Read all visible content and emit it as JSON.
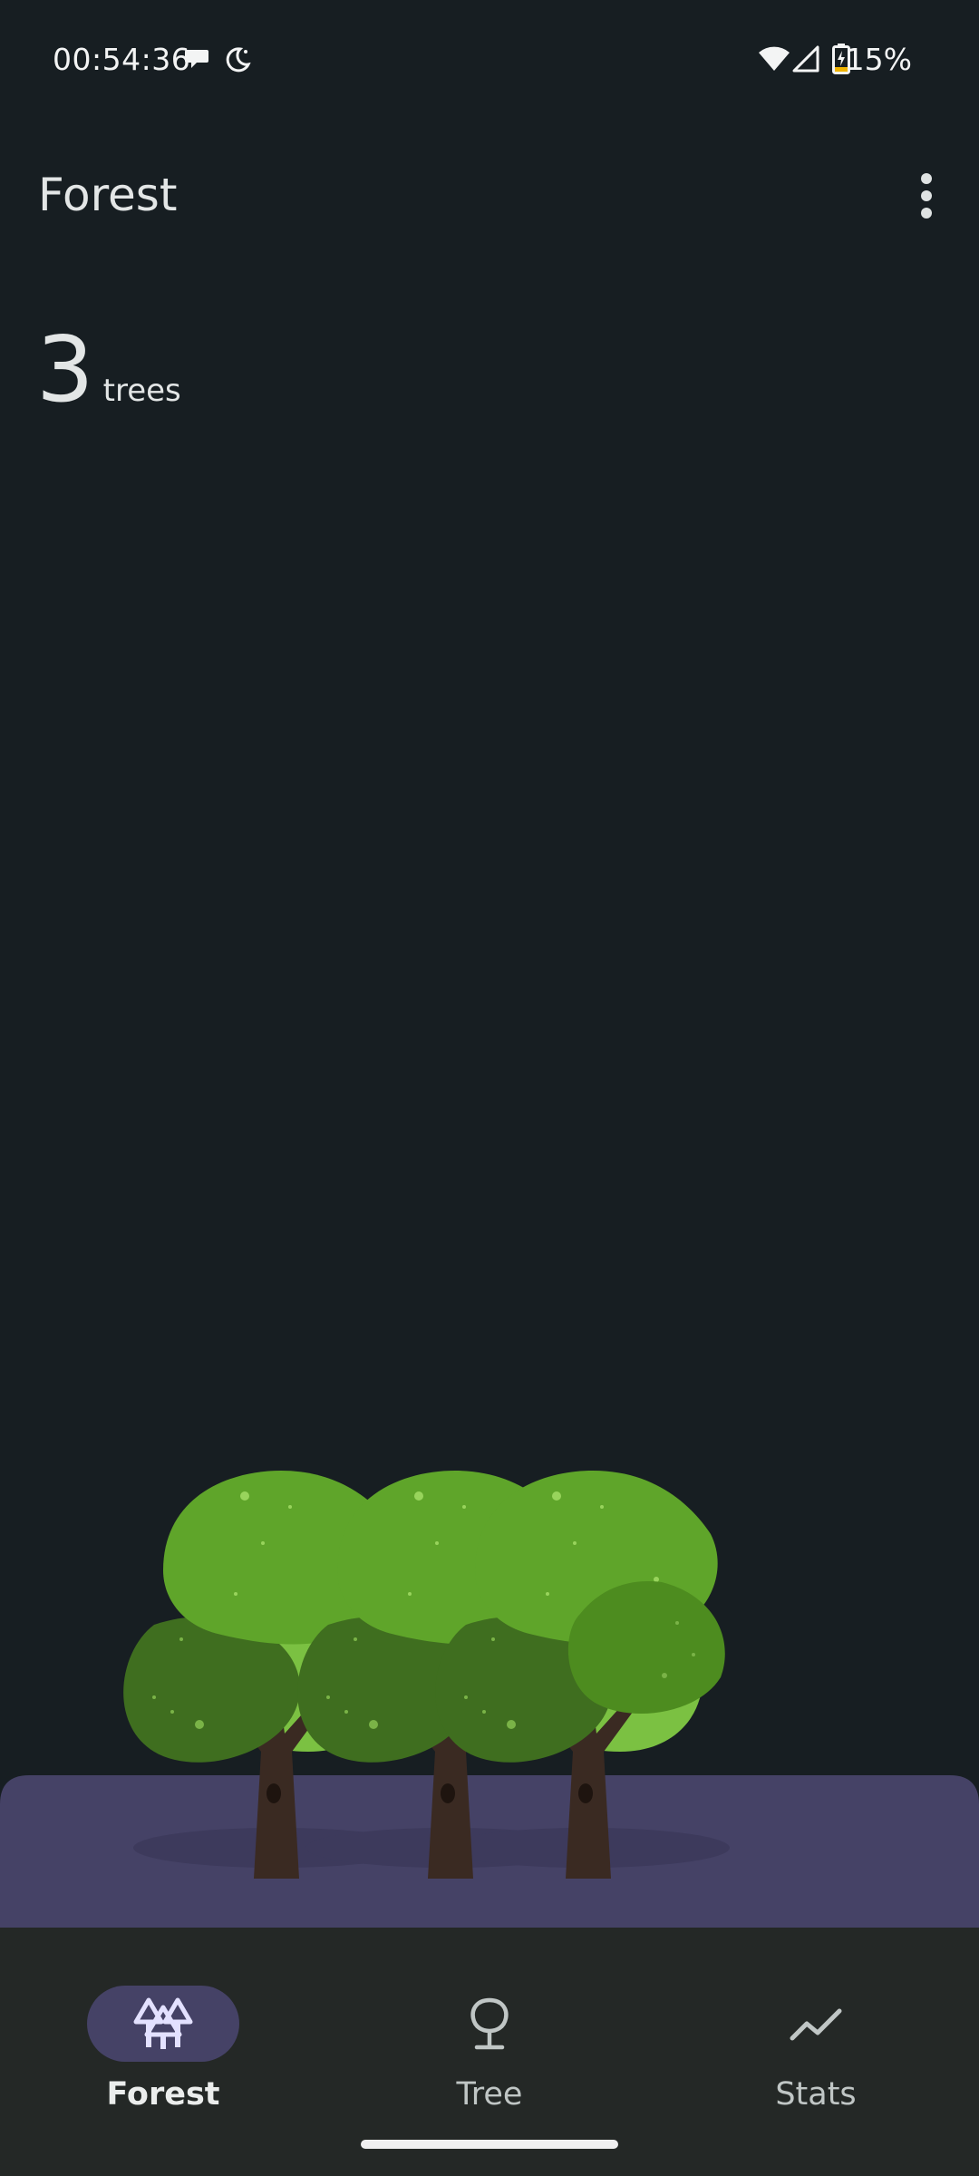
{
  "status_bar": {
    "time": "00:54:36",
    "battery_percent": "15%",
    "icons": [
      "chat-bubble-icon",
      "do-not-disturb-moon-icon",
      "wifi-icon",
      "cellular-signal-icon",
      "battery-charging-icon"
    ]
  },
  "app_bar": {
    "title": "Forest",
    "menu_icon": "more-vert-icon"
  },
  "summary": {
    "count": "3",
    "unit": "trees"
  },
  "scene": {
    "tree_count": 3,
    "colors": {
      "background": "#171e22",
      "ground": "#454266",
      "leaf_light": "#5fa52a",
      "leaf_dark": "#3f6e1f",
      "leaf_back": "#7bc142",
      "trunk": "#3a2a22"
    }
  },
  "bottom_nav": {
    "items": [
      {
        "label": "Forest",
        "icon": "forest-icon",
        "active": true
      },
      {
        "label": "Tree",
        "icon": "tree-icon",
        "active": false
      },
      {
        "label": "Stats",
        "icon": "stats-trend-icon",
        "active": false
      }
    ]
  }
}
